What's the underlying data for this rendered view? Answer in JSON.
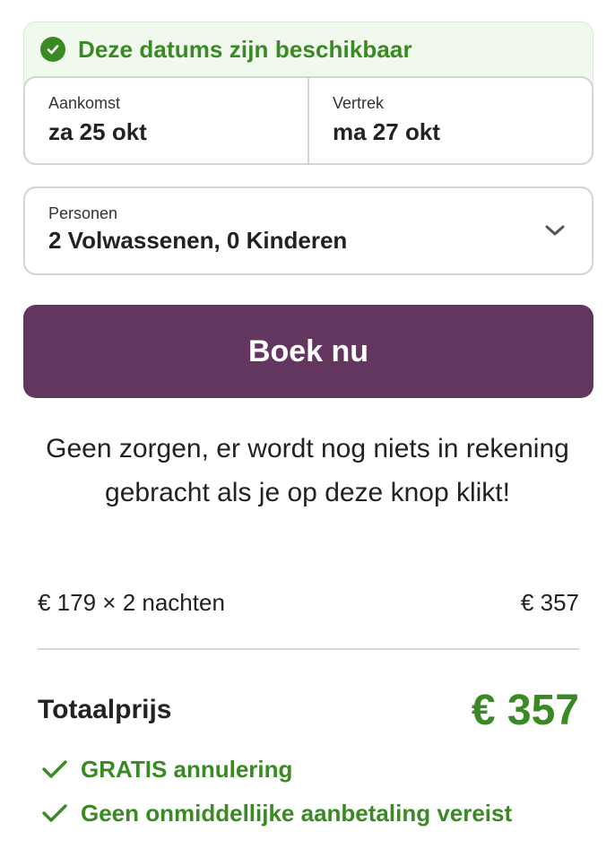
{
  "availability": {
    "message": "Deze datums zijn beschikbaar",
    "icon": "check-circle-icon",
    "color": "#3a8a24",
    "background": "#f1f8ee"
  },
  "dates": {
    "arrival_label": "Aankomst",
    "arrival_value": "za 25 okt",
    "departure_label": "Vertrek",
    "departure_value": "ma 27 okt"
  },
  "persons": {
    "label": "Personen",
    "value": "2 Volwassenen, 0 Kinderen",
    "icon": "chevron-down-icon"
  },
  "book_button": {
    "label": "Boek nu",
    "color": "#62365e"
  },
  "note": "Geen zorgen, er wordt nog niets in rekening gebracht als je op deze knop klikt!",
  "price_breakdown": {
    "description": "€ 179 × 2 nachten",
    "amount": "€ 357"
  },
  "total": {
    "label": "Totaalprijs",
    "value": "€ 357",
    "color": "#3a8a24"
  },
  "perks": [
    {
      "label": "GRATIS annulering",
      "icon": "checkmark-icon"
    },
    {
      "label": "Geen onmiddellijke aanbetaling vereist",
      "icon": "checkmark-icon"
    }
  ]
}
